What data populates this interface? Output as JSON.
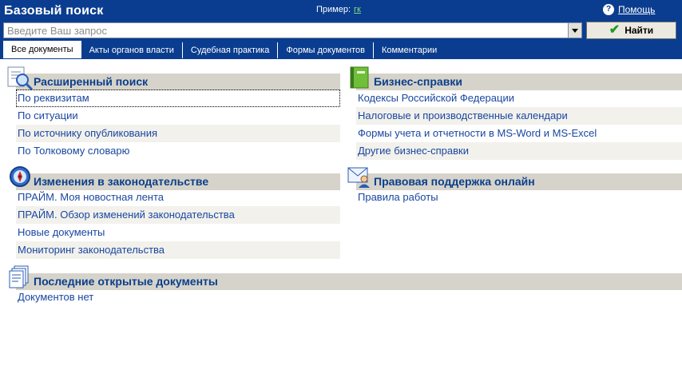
{
  "header": {
    "title": "Базовый поиск",
    "example_label": "Пример:",
    "example_link": "гк",
    "help_label": "Помощь"
  },
  "search": {
    "placeholder": "Введите Ваш запрос",
    "find_label": "Найти"
  },
  "tabs": [
    "Все документы",
    "Акты органов власти",
    "Судебная практика",
    "Формы документов",
    "Комментарии"
  ],
  "sections": {
    "advanced": {
      "title": "Расширенный поиск",
      "icon": "magnifier-icon",
      "items": [
        "По реквизитам",
        "По ситуации",
        "По источнику опубликования",
        "По Толковому словарю"
      ]
    },
    "business": {
      "title": "Бизнес-справки",
      "icon": "book-icon",
      "items": [
        "Кодексы Российской Федерации",
        "Налоговые и производственные календари",
        "Формы учета и отчетности в MS-Word и MS-Excel",
        "Другие бизнес-справки"
      ]
    },
    "changes": {
      "title": "Изменения в законодательстве",
      "icon": "compass-icon",
      "items": [
        "ПРАЙМ. Моя новостная лента",
        "ПРАЙМ. Обзор изменений законодательства",
        "Новые документы",
        "Мониторинг законодательства"
      ]
    },
    "support": {
      "title": "Правовая поддержка онлайн",
      "icon": "mail-person-icon",
      "items": [
        "Правила работы"
      ]
    },
    "recent": {
      "title": "Последние открытые документы",
      "icon": "documents-icon",
      "items": [
        "Документов нет"
      ]
    }
  }
}
